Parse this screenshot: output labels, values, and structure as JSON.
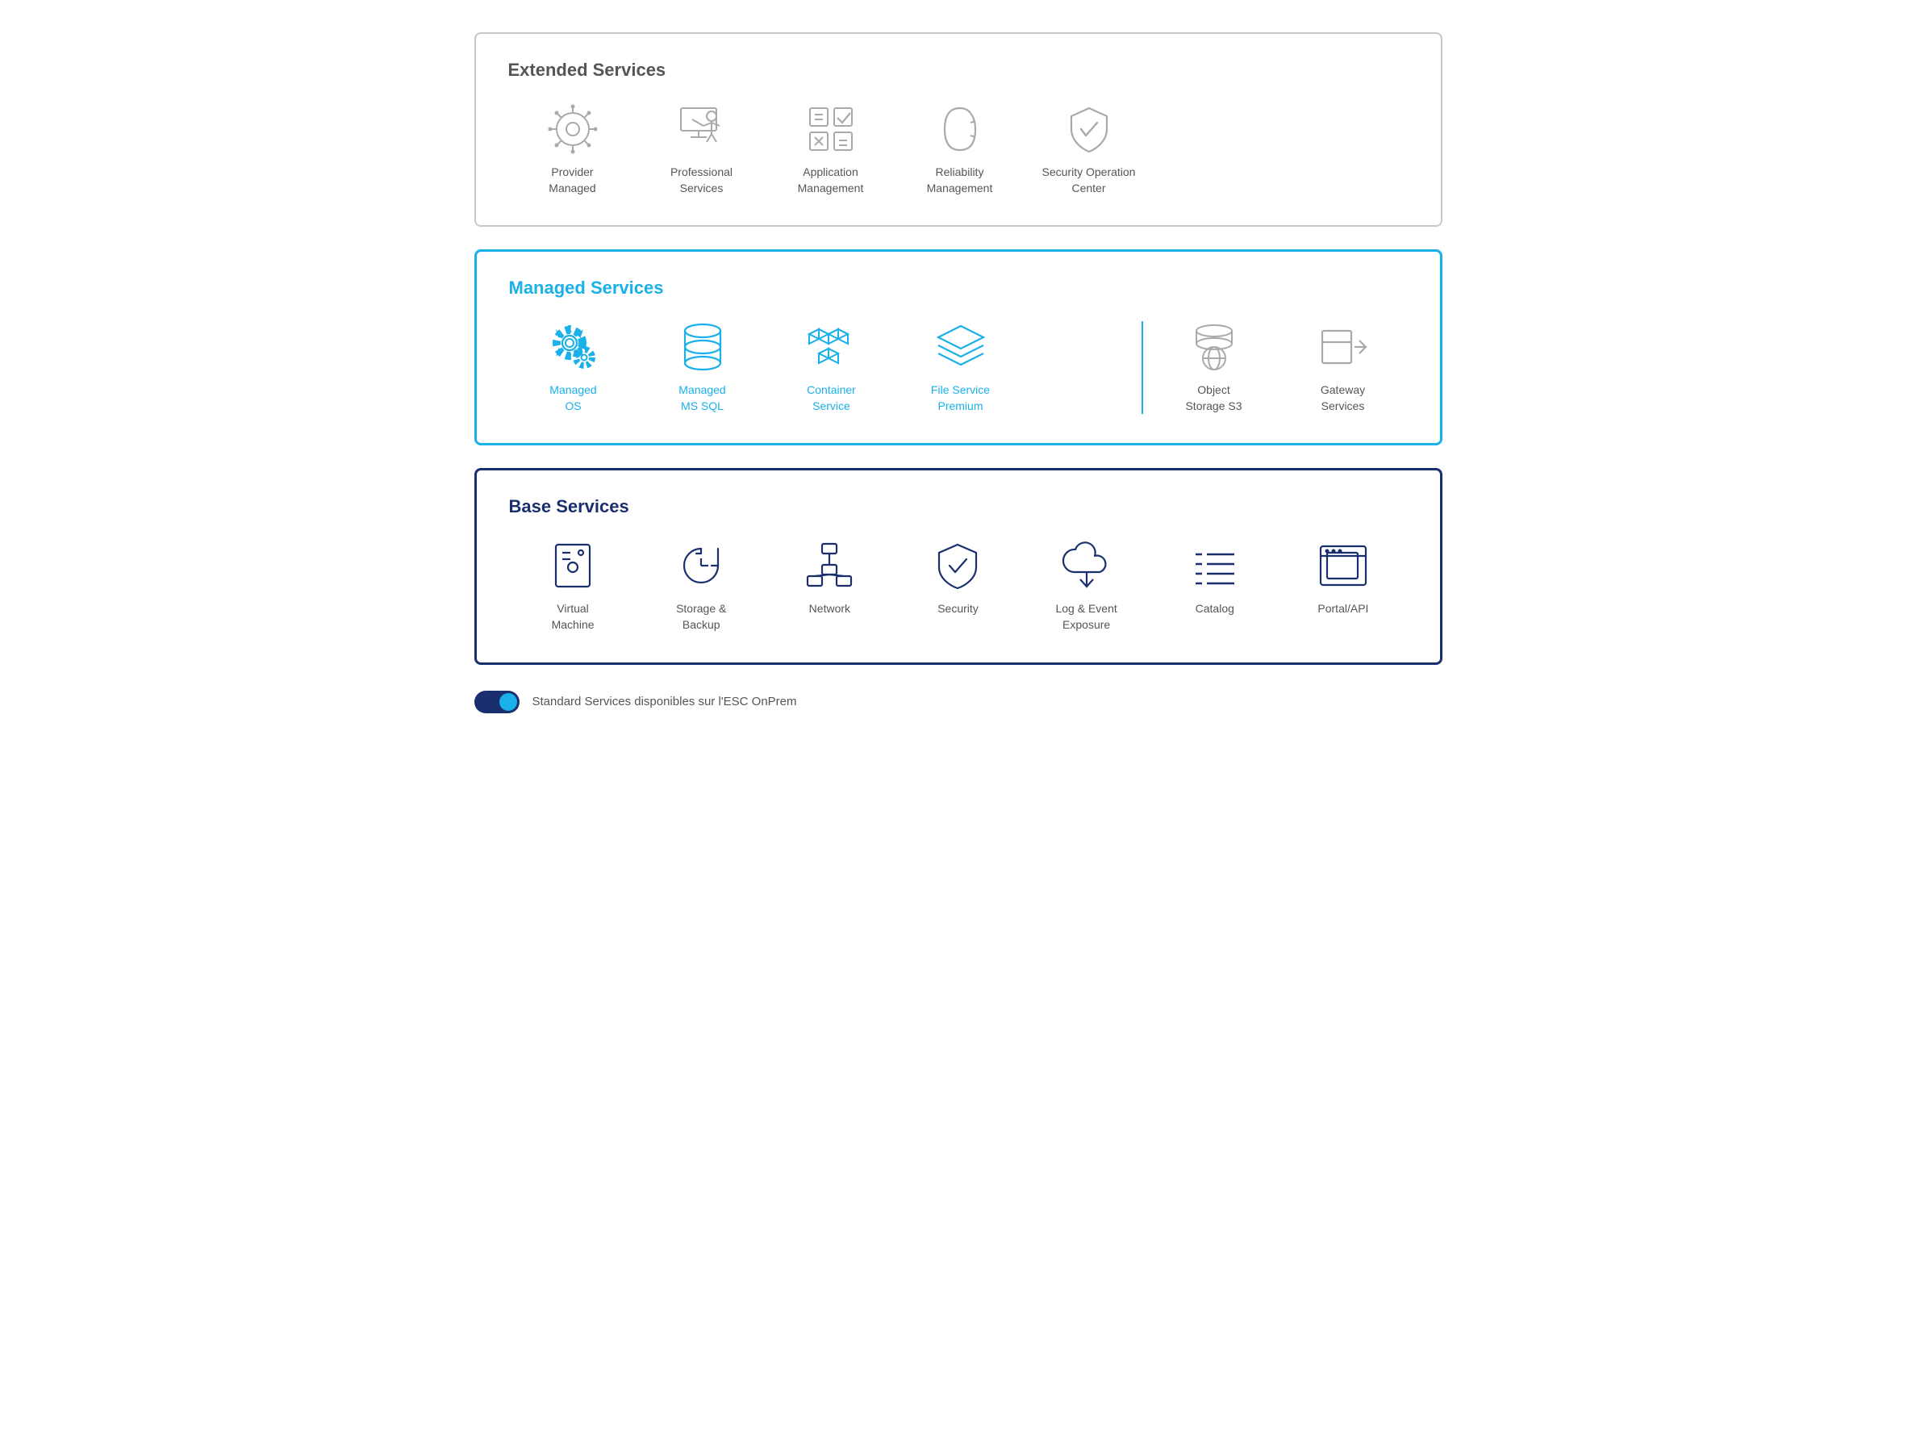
{
  "extended": {
    "title": "Extended Services",
    "items": [
      {
        "id": "provider-managed",
        "label": "Provider\nManaged",
        "icon": "helm"
      },
      {
        "id": "professional-services",
        "label": "Professional\nServices",
        "icon": "presenter"
      },
      {
        "id": "application-management",
        "label": "Application\nManagement",
        "icon": "appgrid"
      },
      {
        "id": "reliability-management",
        "label": "Reliability\nManagement",
        "icon": "carabiner"
      },
      {
        "id": "security-operation-center",
        "label": "Security Operation\nCenter",
        "icon": "shield-check"
      }
    ]
  },
  "managed": {
    "title": "Managed Services",
    "items_left": [
      {
        "id": "managed-os",
        "label": "Managed\nOS",
        "icon": "gear-gear"
      },
      {
        "id": "managed-ms-sql",
        "label": "Managed\nMS SQL",
        "icon": "database"
      },
      {
        "id": "container-service",
        "label": "Container\nService",
        "icon": "cubes"
      },
      {
        "id": "file-service-premium",
        "label": "File Service\nPremium",
        "icon": "layers"
      }
    ],
    "items_right": [
      {
        "id": "object-storage-s3",
        "label": "Object\nStorage S3",
        "icon": "db-globe"
      },
      {
        "id": "gateway-services",
        "label": "Gateway\nServices",
        "icon": "box-arrow"
      }
    ]
  },
  "base": {
    "title": "Base Services",
    "items": [
      {
        "id": "virtual-machine",
        "label": "Virtual\nMachine",
        "icon": "server"
      },
      {
        "id": "storage-backup",
        "label": "Storage &\nBackup",
        "icon": "clock-back"
      },
      {
        "id": "network",
        "label": "Network",
        "icon": "network"
      },
      {
        "id": "security",
        "label": "Security",
        "icon": "shield-check-outline"
      },
      {
        "id": "log-event-exposure",
        "label": "Log & Event\nExposure",
        "icon": "cloud-download"
      },
      {
        "id": "catalog",
        "label": "Catalog",
        "icon": "list-lines"
      },
      {
        "id": "portal-api",
        "label": "Portal/API",
        "icon": "window"
      }
    ]
  },
  "legend": {
    "text": "Standard Services disponibles sur l'ESC OnPrem"
  }
}
